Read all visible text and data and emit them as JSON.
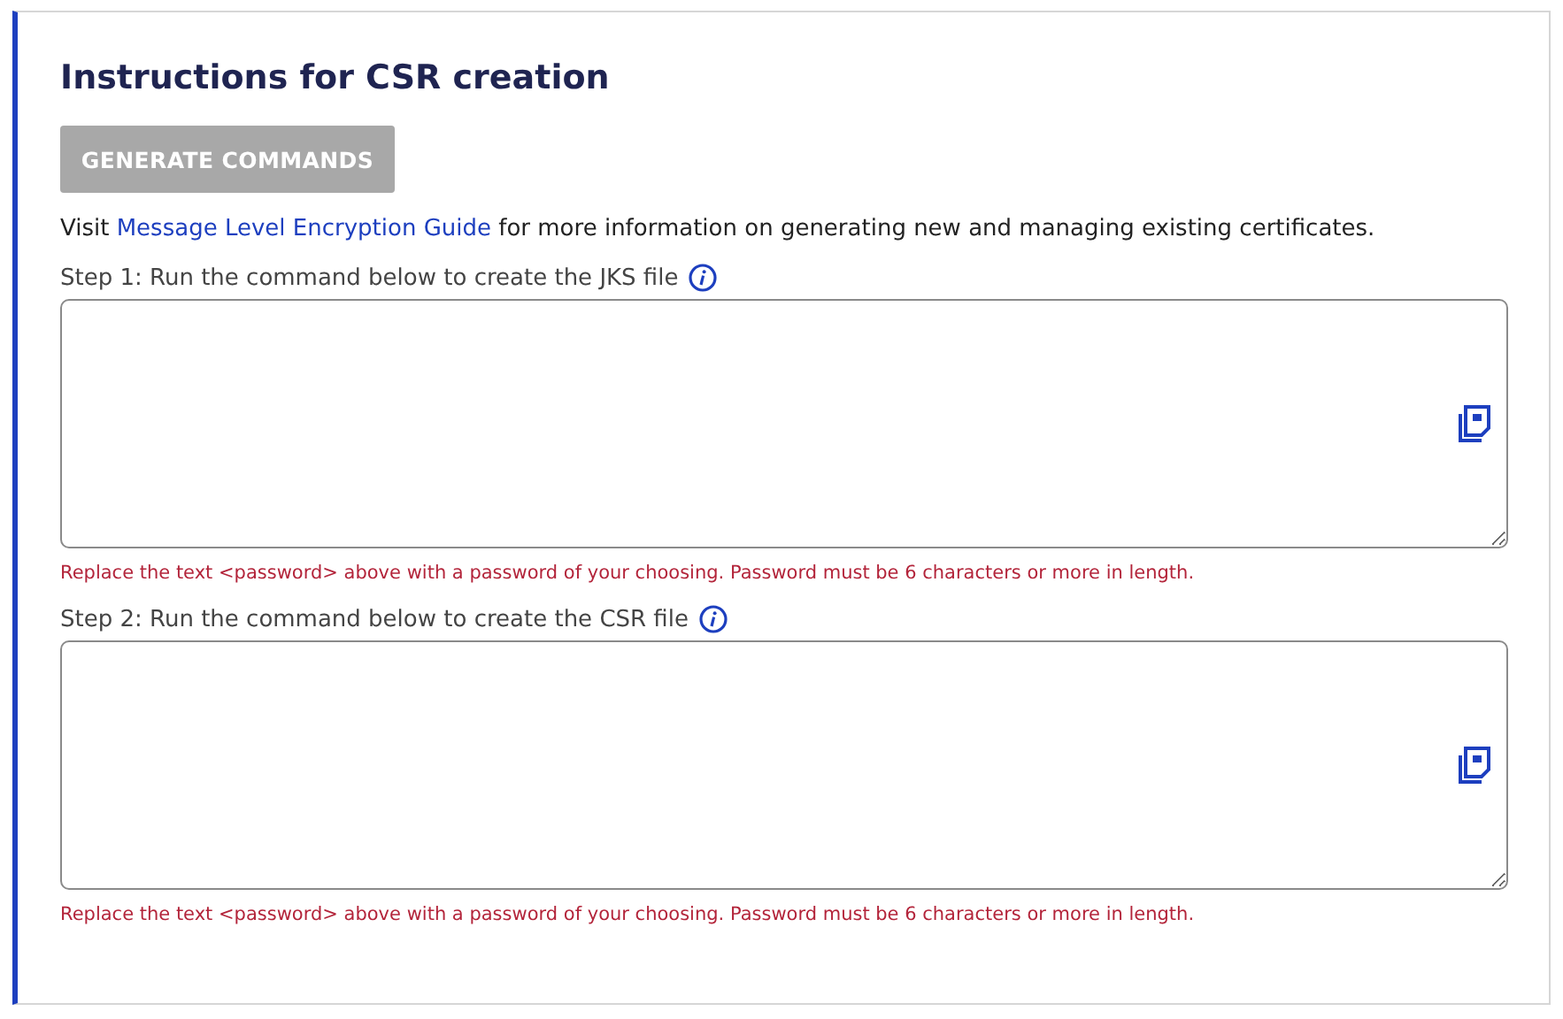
{
  "title": "Instructions for CSR creation",
  "generate_button": {
    "label": "GENERATE COMMANDS",
    "disabled": true
  },
  "intro": {
    "before": "Visit",
    "link": "Message Level Encryption Guide",
    "after": "for more information on generating new and managing existing certificates."
  },
  "steps": [
    {
      "label": "Step 1: Run the command below to create the JKS file",
      "hint": "Replace the text <password> above with a password of your choosing. Password must be 6 characters or more in length."
    },
    {
      "label": "Step 2: Run the command below to create the CSR file",
      "hint": "Replace the text <password> above with a password of your choosing. Password must be 6 characters or more in length."
    }
  ]
}
